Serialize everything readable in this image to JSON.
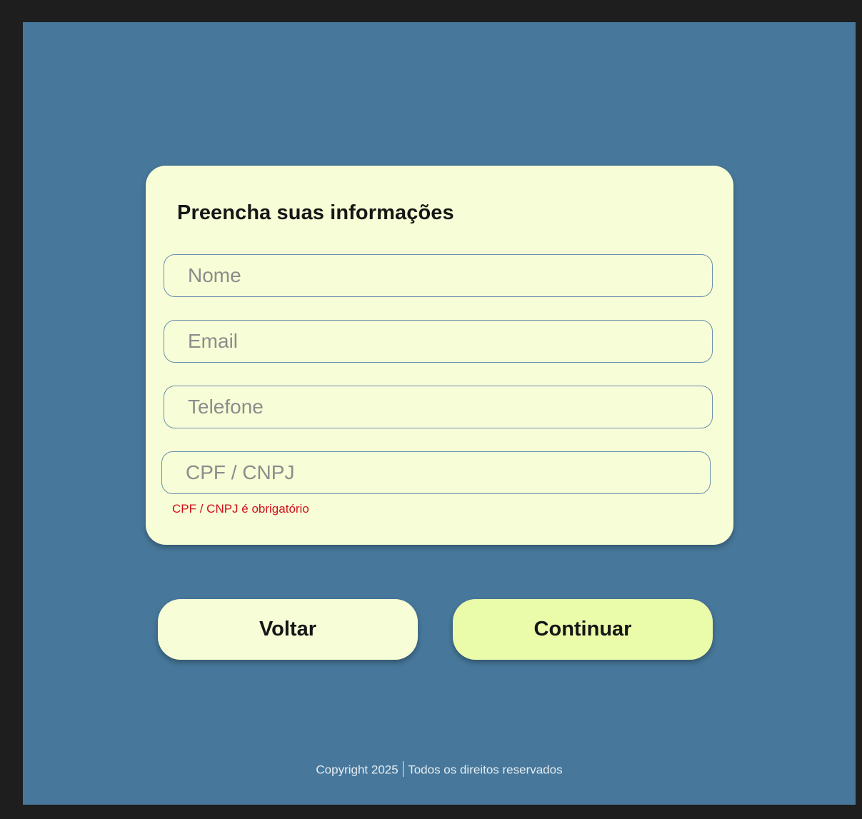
{
  "form": {
    "title": "Preencha suas informações",
    "fields": [
      {
        "placeholder": "Nome"
      },
      {
        "placeholder": "Email"
      },
      {
        "placeholder": "Telefone"
      },
      {
        "placeholder": "CPF / CNPJ"
      }
    ],
    "error": "CPF / CNPJ é obrigatório"
  },
  "actions": {
    "back_label": "Voltar",
    "continue_label": "Continuar"
  },
  "footer": {
    "copyright": "Copyright 2025",
    "rights": "Todos os direitos reservados"
  },
  "colors": {
    "background": "#47789b",
    "card": "#f7fdd6",
    "primary_button": "#eafcaa",
    "error": "#d0101b"
  }
}
